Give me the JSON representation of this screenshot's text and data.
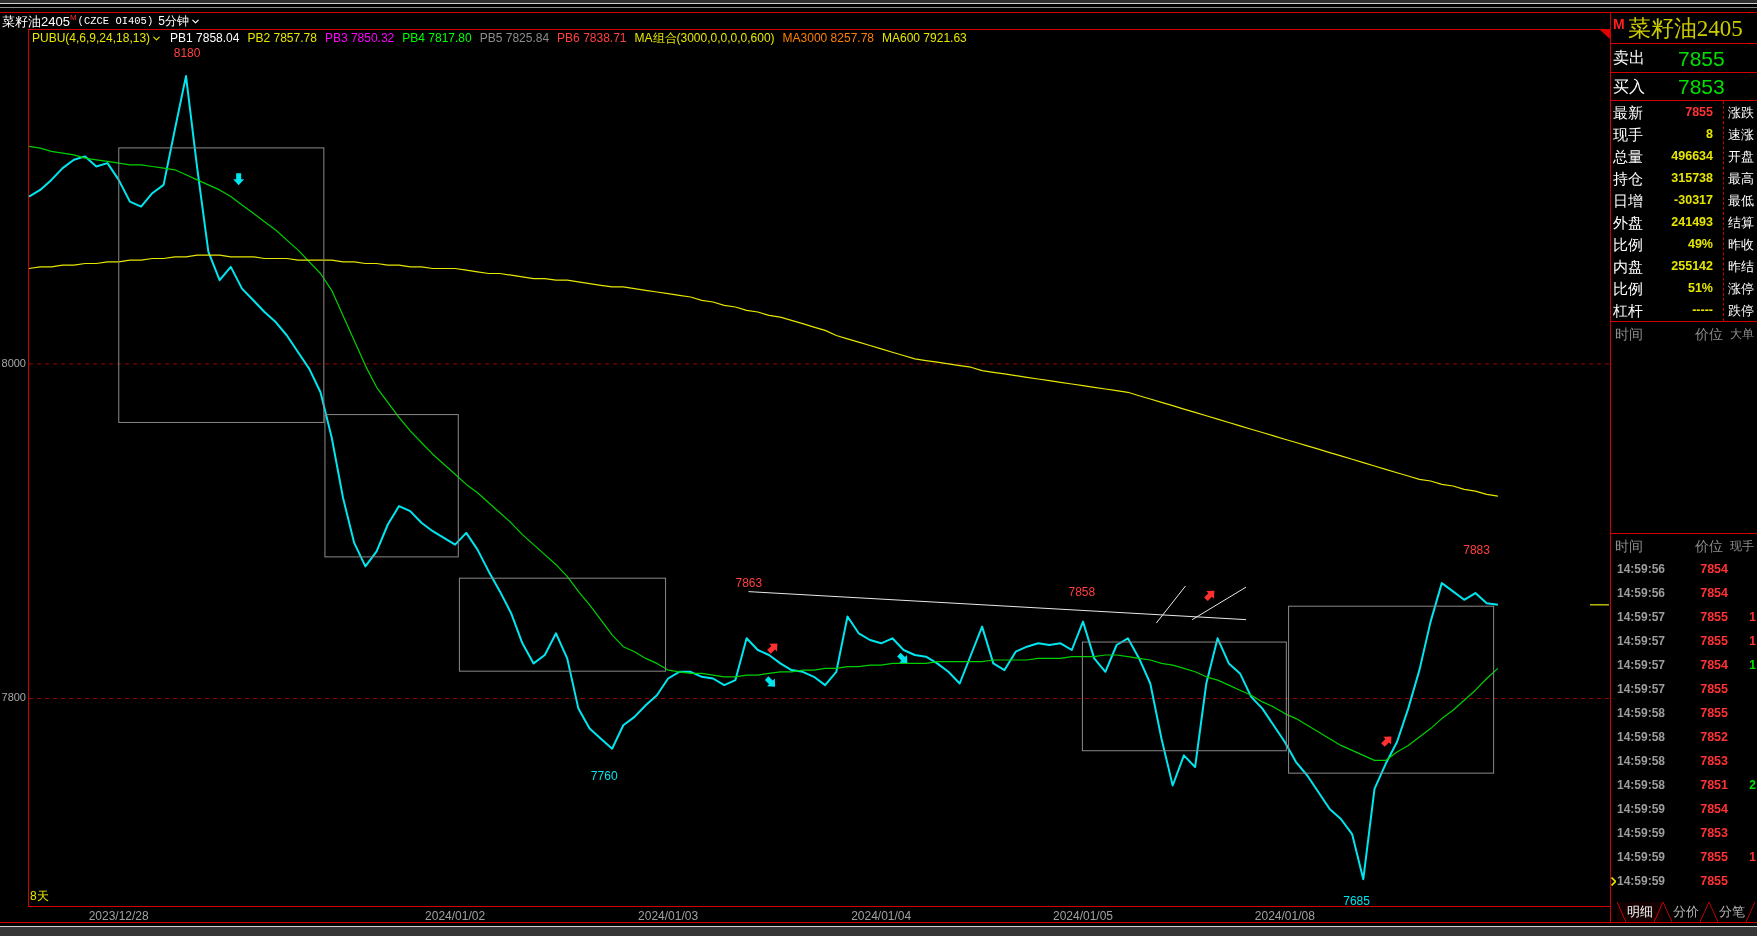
{
  "title_bar": {
    "name": "菜籽油2405",
    "market_flag": "M",
    "code": "(CZCE OI405)",
    "period": "5分钟"
  },
  "indicator_selector": {
    "label": "PUBU(4,6,9,24,18,13)"
  },
  "indicators": [
    {
      "label": "PB1 7858.04",
      "color": "#ffffff"
    },
    {
      "label": "PB2 7857.78",
      "color": "#e6e600"
    },
    {
      "label": "PB3 7850.32",
      "color": "#ff00ff"
    },
    {
      "label": "PB4 7817.80",
      "color": "#00ff00"
    },
    {
      "label": "PB5 7825.84",
      "color": "#8c8c8c"
    },
    {
      "label": "PB6 7838.71",
      "color": "#ff4040"
    },
    {
      "label": "MA组合(3000,0,0,0,0,600)",
      "color": "#e6e600"
    },
    {
      "label": "MA3000 8257.78",
      "color": "#ff8000"
    },
    {
      "label": "MA600 7921.63",
      "color": "#e6e600"
    }
  ],
  "chart": {
    "day_span": "8天",
    "chart_data": {
      "type": "line",
      "ylim": [
        7676,
        8190
      ],
      "yticks": [
        7800,
        8000
      ],
      "categories": [
        null,
        null,
        null,
        null,
        null,
        null,
        null,
        null,
        "2023/12/28",
        null,
        null,
        null,
        null,
        null,
        null,
        null,
        null,
        null,
        null,
        null,
        null,
        null,
        null,
        null,
        null,
        null,
        null,
        null,
        null,
        null,
        null,
        null,
        null,
        null,
        null,
        null,
        null,
        null,
        "2024/01/02",
        null,
        null,
        null,
        null,
        null,
        null,
        null,
        null,
        null,
        null,
        null,
        null,
        null,
        null,
        null,
        null,
        null,
        null,
        "2024/01/03",
        null,
        null,
        null,
        null,
        null,
        null,
        null,
        null,
        null,
        null,
        null,
        null,
        null,
        null,
        null,
        null,
        null,
        null,
        "2024/01/04",
        null,
        null,
        null,
        null,
        null,
        null,
        null,
        null,
        null,
        null,
        null,
        null,
        null,
        null,
        null,
        null,
        null,
        "2024/01/05",
        null,
        null,
        null,
        null,
        null,
        null,
        null,
        null,
        null,
        null,
        null,
        null,
        null,
        null,
        null,
        null,
        null,
        "2024/01/08",
        null,
        null,
        null,
        null,
        null,
        null,
        null,
        null,
        null,
        null,
        null,
        null,
        null,
        null,
        null,
        null,
        null,
        null,
        null
      ],
      "series": [
        {
          "color": "#00e5ee",
          "values": [
            8100,
            8104,
            8110,
            8117,
            8122,
            8124,
            8118,
            8120,
            8110,
            8097,
            8094,
            8102,
            8107,
            8140,
            8172,
            8117,
            8067,
            8050,
            8058,
            8045,
            8038,
            8031,
            8025,
            8017,
            8007,
            7997,
            7983,
            7956,
            7920,
            7893,
            7879,
            7888,
            7904,
            7915,
            7912,
            7905,
            7900,
            7896,
            7892,
            7899,
            7889,
            7876,
            7864,
            7851,
            7833,
            7821,
            7826,
            7839,
            7824,
            7794,
            7782,
            7776,
            7770,
            7784,
            7789,
            7796,
            7802,
            7812,
            7816,
            7816,
            7813,
            7812,
            7808,
            7811,
            7836,
            7829,
            7826,
            7821,
            7817,
            7816,
            7813,
            7808,
            7816,
            7849,
            7839,
            7835,
            7833,
            7836,
            7829,
            7826,
            7825,
            7821,
            7816,
            7809,
            7826,
            7843,
            7821,
            7817,
            7828,
            7831,
            7833,
            7832,
            7833,
            7829,
            7846,
            7824,
            7816,
            7832,
            7836,
            7824,
            7809,
            7776,
            7748,
            7766,
            7759,
            7809,
            7836,
            7821,
            7815,
            7801,
            7794,
            7784,
            7774,
            7762,
            7754,
            7744,
            7734,
            7728,
            7719,
            7692,
            7746,
            7761,
            7774,
            7794,
            7817,
            7846,
            7869,
            7864,
            7859,
            7863,
            7857,
            7856
          ]
        },
        {
          "color": "#00d000",
          "values": [
            8130,
            8129,
            8127,
            8126,
            8125,
            8123,
            8122,
            8121,
            8120,
            8119,
            8119,
            8118,
            8117,
            8116,
            8113,
            8110,
            8107,
            8104,
            8100,
            8095,
            8090,
            8085,
            8080,
            8074,
            8068,
            8061,
            8054,
            8044,
            8029,
            8014,
            7999,
            7986,
            7977,
            7968,
            7960,
            7953,
            7946,
            7940,
            7934,
            7928,
            7923,
            7917,
            7911,
            7905,
            7898,
            7892,
            7886,
            7880,
            7873,
            7864,
            7856,
            7847,
            7838,
            7831,
            7828,
            7824,
            7821,
            7817,
            7816,
            7815,
            7815,
            7814,
            7813,
            7813,
            7814,
            7814,
            7815,
            7816,
            7816,
            7817,
            7817,
            7818,
            7818,
            7819,
            7819,
            7820,
            7820,
            7821,
            7821,
            7821,
            7821,
            7822,
            7822,
            7822,
            7822,
            7822,
            7823,
            7823,
            7823,
            7823,
            7824,
            7824,
            7824,
            7825,
            7825,
            7825,
            7826,
            7826,
            7825,
            7824,
            7823,
            7821,
            7820,
            7818,
            7816,
            7813,
            7811,
            7808,
            7805,
            7802,
            7798,
            7795,
            7791,
            7788,
            7784,
            7780,
            7776,
            7772,
            7769,
            7766,
            7763,
            7763,
            7768,
            7772,
            7777,
            7782,
            7788,
            7793,
            7799,
            7805,
            7812,
            7818
          ]
        },
        {
          "color": "#e6e600",
          "values": [
            8057,
            8058,
            8058,
            8059,
            8059,
            8060,
            8060,
            8061,
            8061,
            8062,
            8062,
            8063,
            8063,
            8064,
            8064,
            8065,
            8065,
            8065,
            8064,
            8064,
            8064,
            8063,
            8063,
            8063,
            8062,
            8062,
            8062,
            8062,
            8061,
            8061,
            8060,
            8060,
            8059,
            8059,
            8058,
            8058,
            8057,
            8057,
            8057,
            8056,
            8055,
            8054,
            8054,
            8053,
            8052,
            8051,
            8051,
            8050,
            8050,
            8049,
            8048,
            8047,
            8046,
            8046,
            8045,
            8044,
            8043,
            8042,
            8041,
            8040,
            8038,
            8037,
            8035,
            8034,
            8032,
            8031,
            8029,
            8028,
            8026,
            8024,
            8022,
            8020,
            8017,
            8015,
            8013,
            8011,
            8009,
            8007,
            8005,
            8003,
            8002,
            8001,
            8000,
            7999,
            7998,
            7996,
            7995,
            7994,
            7993,
            7992,
            7991,
            7990,
            7989,
            7988,
            7987,
            7986,
            7985,
            7984,
            7983,
            7981,
            7979,
            7977,
            7975,
            7973,
            7971,
            7969,
            7967,
            7965,
            7963,
            7961,
            7959,
            7957,
            7955,
            7953,
            7951,
            7949,
            7947,
            7945,
            7943,
            7941,
            7939,
            7937,
            7935,
            7933,
            7931,
            7930,
            7928,
            7927,
            7925,
            7924,
            7922,
            7921
          ]
        }
      ],
      "annotations": [
        "8180",
        "7760",
        "7863",
        "7858",
        "7685",
        "7883"
      ]
    }
  },
  "quote_panel": {
    "market_flag": "M",
    "name": "菜籽油2405",
    "order_book": [
      {
        "label": "卖出",
        "price": "7855"
      },
      {
        "label": "买入",
        "price": "7853"
      }
    ],
    "stats": [
      {
        "label": "最新",
        "value": "7855",
        "color": "#ff3333",
        "right_label": "涨跌"
      },
      {
        "label": "现手",
        "value": "8",
        "color": "#e6e600",
        "right_label": "速涨"
      },
      {
        "label": "总量",
        "value": "496634",
        "color": "#e6e600",
        "right_label": "开盘"
      },
      {
        "label": "持仓",
        "value": "315738",
        "color": "#e6e600",
        "right_label": "最高"
      },
      {
        "label": "日增",
        "value": "-30317",
        "color": "#e6e600",
        "right_label": "最低"
      },
      {
        "label": "外盘",
        "value": "241493",
        "color": "#e6e600",
        "right_label": "结算"
      },
      {
        "label": "比例",
        "value": "49%",
        "color": "#e6e600",
        "right_label": "昨收"
      },
      {
        "label": "内盘",
        "value": "255142",
        "color": "#e6e600",
        "right_label": "昨结"
      },
      {
        "label": "比例",
        "value": "51%",
        "color": "#e6e600",
        "right_label": "涨停"
      },
      {
        "label": "杠杆",
        "value": "-----",
        "color": "#e6e600",
        "right_label": "跌停"
      }
    ],
    "trade_columns": [
      "时间",
      "价位",
      "大单"
    ]
  },
  "tick_list": {
    "columns": [
      "时间",
      "价位",
      "现手"
    ],
    "rows": [
      {
        "time": "14:59:56",
        "price": "7854",
        "current": false
      },
      {
        "time": "14:59:56",
        "price": "7854",
        "current": false
      },
      {
        "time": "14:59:57",
        "price": "7855",
        "volume": "1",
        "color": "#ff3333",
        "current": false
      },
      {
        "time": "14:59:57",
        "price": "7855",
        "volume": "1",
        "color": "#ff3333",
        "current": false
      },
      {
        "time": "14:59:57",
        "price": "7854",
        "volume": "1",
        "color": "#00e000",
        "current": false
      },
      {
        "time": "14:59:57",
        "price": "7855",
        "current": false
      },
      {
        "time": "14:59:58",
        "price": "7855",
        "current": false
      },
      {
        "time": "14:59:58",
        "price": "7852",
        "current": false
      },
      {
        "time": "14:59:58",
        "price": "7853",
        "current": false
      },
      {
        "time": "14:59:58",
        "price": "7851",
        "volume": "2",
        "color": "#00e000",
        "current": false
      },
      {
        "time": "14:59:59",
        "price": "7854",
        "current": false
      },
      {
        "time": "14:59:59",
        "price": "7853",
        "current": false
      },
      {
        "time": "14:59:59",
        "price": "7855",
        "volume": "1",
        "color": "#ff3333",
        "current": false
      },
      {
        "time": "14:59:59",
        "price": "7855",
        "current": true
      }
    ]
  },
  "tabs": [
    {
      "label": "明细",
      "selected": true
    },
    {
      "label": "分价",
      "selected": false
    },
    {
      "label": "分笔",
      "selected": false
    }
  ]
}
